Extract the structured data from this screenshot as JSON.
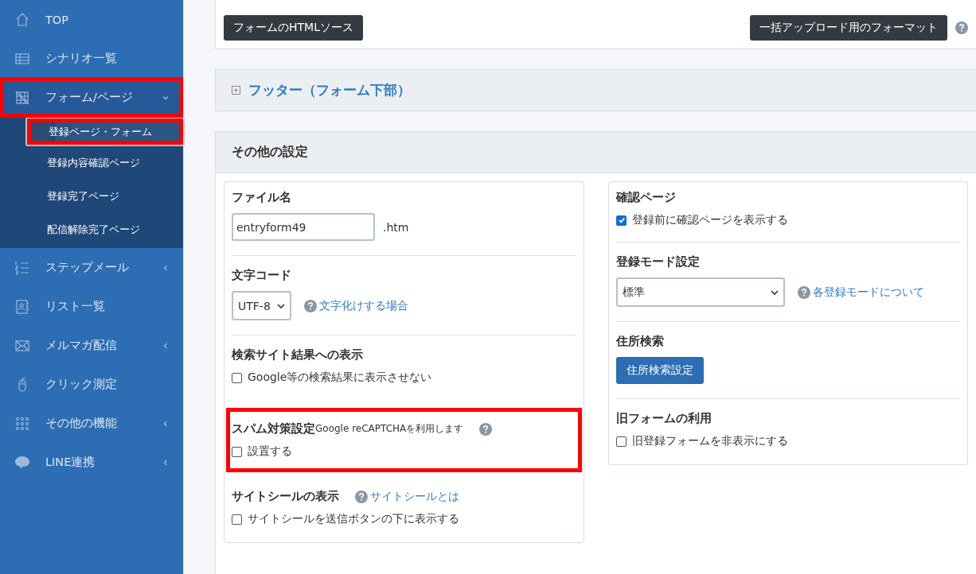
{
  "sidebar": {
    "items": [
      {
        "label": "TOP",
        "expandable": false,
        "expanded": false,
        "highlighted": false
      },
      {
        "label": "シナリオ一覧",
        "expandable": false,
        "expanded": false,
        "highlighted": false
      },
      {
        "label": "フォーム/ページ",
        "expandable": true,
        "expanded": true,
        "highlighted": true,
        "children": [
          {
            "label": "登録ページ・フォーム",
            "selected": true,
            "highlighted": true
          },
          {
            "label": "登録内容確認ページ",
            "selected": false,
            "highlighted": false
          },
          {
            "label": "登録完了ページ",
            "selected": false,
            "highlighted": false
          },
          {
            "label": "配信解除完了ページ",
            "selected": false,
            "highlighted": false
          }
        ]
      },
      {
        "label": "ステップメール",
        "expandable": true,
        "expanded": false,
        "highlighted": false
      },
      {
        "label": "リスト一覧",
        "expandable": false,
        "expanded": false,
        "highlighted": false
      },
      {
        "label": "メルマガ配信",
        "expandable": true,
        "expanded": false,
        "highlighted": false
      },
      {
        "label": "クリック測定",
        "expandable": false,
        "expanded": false,
        "highlighted": false
      },
      {
        "label": "その他の機能",
        "expandable": true,
        "expanded": false,
        "highlighted": false
      },
      {
        "label": "LINE連携",
        "expandable": true,
        "expanded": false,
        "highlighted": false
      }
    ]
  },
  "toolbar": {
    "buttons": [
      "フォームのHTMLソース",
      "一括アップロード用のフォーマット"
    ]
  },
  "footer_panel": {
    "title": "フッター（フォーム下部）",
    "expanded": false
  },
  "settings_panel": {
    "title": "その他の設定",
    "columns": [
      [
        {
          "kind": "section",
          "title": "ファイル名",
          "controls": [
            {
              "kind": "input",
              "value": "entryform49"
            },
            {
              "kind": "text",
              "text": ".htm"
            }
          ]
        },
        {
          "kind": "divider"
        },
        {
          "kind": "section",
          "title": "文字コード",
          "controls": [
            {
              "kind": "select",
              "value": "UTF-8"
            },
            {
              "kind": "helplink",
              "text": "文字化けする場合"
            }
          ]
        },
        {
          "kind": "divider"
        },
        {
          "kind": "section",
          "title": "検索サイト結果への表示",
          "controls": [
            {
              "kind": "checkbox",
              "label": "Google等の検索結果に表示させない",
              "checked": false
            }
          ]
        },
        {
          "kind": "framed",
          "title": "スパム対策設定",
          "note": "Google reCAPTCHAを利用します",
          "controls": [
            {
              "kind": "checkbox",
              "label": "設置する",
              "checked": false
            }
          ]
        },
        {
          "kind": "section",
          "title": "サイトシールの表示",
          "title_link": "サイトシールとは",
          "controls": [
            {
              "kind": "checkbox",
              "label": "サイトシールを送信ボタンの下に表示する",
              "checked": false
            }
          ]
        }
      ],
      [
        {
          "kind": "section",
          "title": "確認ページ",
          "controls": [
            {
              "kind": "checkbox",
              "label": "登録前に確認ページを表示する",
              "checked": true
            }
          ]
        },
        {
          "kind": "divider"
        },
        {
          "kind": "section",
          "title": "登録モード設定",
          "controls": [
            {
              "kind": "wideselect",
              "value": "標準"
            },
            {
              "kind": "helplink",
              "text": "各登録モードについて"
            }
          ]
        },
        {
          "kind": "divider"
        },
        {
          "kind": "section",
          "title": "住所検索",
          "controls": [
            {
              "kind": "button",
              "text": "住所検索設定"
            }
          ]
        },
        {
          "kind": "divider"
        },
        {
          "kind": "section",
          "title": "旧フォームの利用",
          "controls": [
            {
              "kind": "checkbox",
              "label": "旧登録フォームを非表示にする",
              "checked": false
            }
          ]
        }
      ]
    ]
  }
}
